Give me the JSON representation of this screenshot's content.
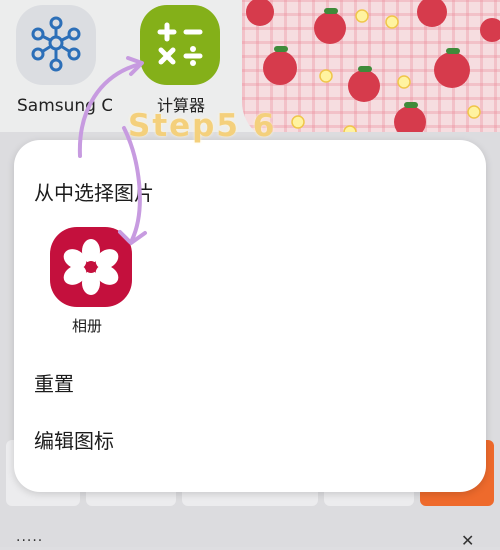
{
  "home": {
    "apps": [
      {
        "label": "Samsung Connect",
        "icon": "samsung-connect-icon"
      },
      {
        "label": "计算器",
        "icon": "calculator-icon"
      }
    ]
  },
  "popup": {
    "pick_image": "从中选择图片",
    "gallery_label": "相册",
    "gallery_icon": "gallery-flower-icon",
    "reset": "重置",
    "edit_icon": "编辑图标"
  },
  "annotation": {
    "step_text": "Step5 6"
  },
  "bottom_bar": {
    "dots": "·····",
    "close": "✕"
  },
  "colors": {
    "calculator": "#84b019",
    "gallery": "#c4103d",
    "annotation_arrow": "#c79be0",
    "step_text": "#f4d07c",
    "accent_key": "#ee6a2c"
  }
}
